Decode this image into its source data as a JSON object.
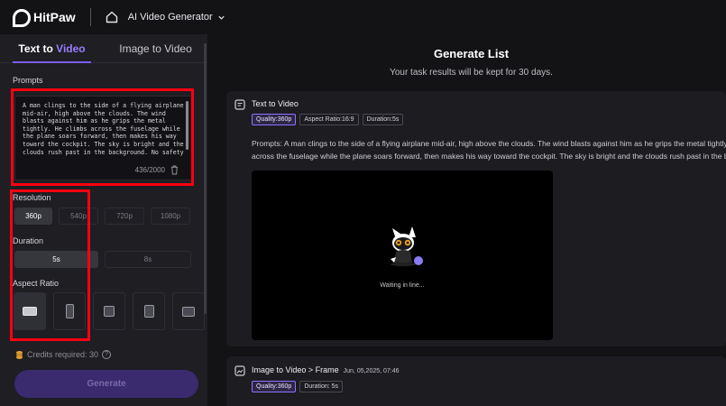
{
  "app": {
    "brand": "HitPaw",
    "product": "AI Video Generator"
  },
  "left_panel": {
    "tabs": [
      {
        "label_prefix": "Text to ",
        "label_accent": "Video",
        "active": true
      },
      {
        "label": "Image to Video",
        "active": false
      }
    ],
    "prompts_label": "Prompts",
    "prompt_text": "A man clings to the side of a flying airplane mid-air, high above the clouds. The wind blasts against him as he grips the metal tightly. He climbs across the fuselage while the plane soars forward, then makes his way toward the cockpit. The sky is bright and the clouds rush past in the background. No safety gear.",
    "char_count": "436/2000",
    "resolution_label": "Resolution",
    "resolution_options": [
      "360p",
      "540p",
      "720p",
      "1080p"
    ],
    "resolution_selected": "360p",
    "duration_label": "Duration",
    "duration_options": [
      "5s",
      "8s"
    ],
    "duration_selected": "5s",
    "aspect_label": "Aspect Ratio",
    "aspect_options": [
      "16:9",
      "9:16",
      "1:1",
      "3:4",
      "4:3"
    ],
    "aspect_selected": "16:9",
    "credits_text": "Credits required: 30",
    "help_glyph": "?",
    "generate_label": "Generate"
  },
  "generate_list": {
    "title": "Generate List",
    "subtitle": "Your task results will be kept for 30 days.",
    "tasks": [
      {
        "title": "Text to Video",
        "chips": [
          "Quality:360p",
          "Aspect Ratio:16:9",
          "Duration:5s"
        ],
        "prompt_line1": "Prompts:  A man clings to the side of a flying airplane mid-air, high above the clouds. The wind blasts against him as he grips the metal tightly. He climbs",
        "prompt_line2": "across the fuselage while the plane soars forward, then makes his way toward the cockpit. The sky is bright and the clouds rush past in the background.",
        "status": "Waiting in line..."
      },
      {
        "title": "Image to Video > Frame",
        "date": "Jun, 05,2025, 07:46",
        "chips": [
          "Quality:360p",
          "Duration: 5s"
        ]
      }
    ]
  },
  "colors": {
    "accent": "#7b5cf6",
    "annotation": "#ff0011",
    "background": "#131316",
    "panel": "#1e1e23"
  }
}
